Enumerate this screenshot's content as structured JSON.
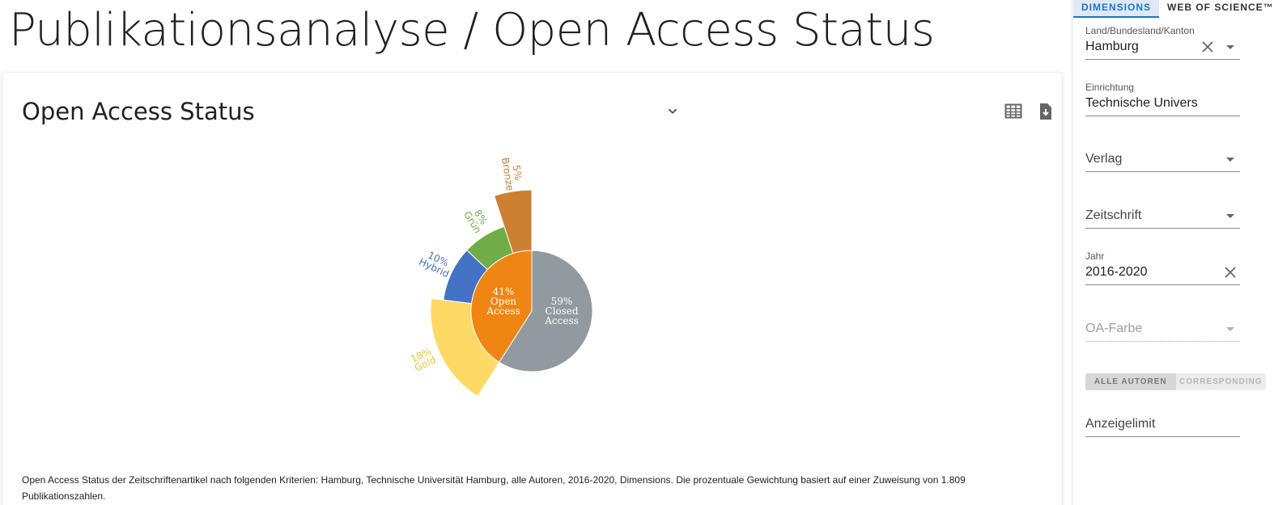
{
  "page": {
    "title": "Publikationsanalyse / Open Access Status"
  },
  "card": {
    "title": "Open Access Status",
    "caption": "Open Access Status der Zeitschriftenartikel nach folgenden Kriterien: Hamburg, Technische Universität Hamburg, alle Autoren, 2016-2020, Dimensions. Die prozentuale Gewichtung basiert auf einer Zuweisung von 1.809 Publikationszahlen.",
    "icons": [
      "chevron-down-icon",
      "table-icon",
      "download-icon"
    ]
  },
  "chart_data": {
    "type": "pie",
    "inner": [
      {
        "label_lines": [
          "41%",
          "Open",
          "Access"
        ],
        "value": 41,
        "color": "#ef8513"
      },
      {
        "label_lines": [
          "59%",
          "Closed",
          "Access"
        ],
        "value": 59,
        "color": "#919a9e"
      }
    ],
    "outer": [
      {
        "pct": "18%",
        "name": "Gold",
        "value": 18,
        "color": "#ffd966"
      },
      {
        "pct": "10%",
        "name": "Hybrid",
        "value": 10,
        "color": "#4472c4"
      },
      {
        "pct": "8%",
        "name": "Grün",
        "value": 8,
        "color": "#70ad47"
      },
      {
        "pct": "5%",
        "name": "Bronze",
        "value": 5,
        "color": "#cd7f32"
      }
    ],
    "outer_label_colors": [
      "#e8c440",
      "#4472c4",
      "#70ad47",
      "#cd7f32"
    ]
  },
  "sidebar": {
    "tabs": [
      {
        "label": "DIMENSIONS",
        "active": true
      },
      {
        "label": "WEB OF SCIENCE™",
        "active": false
      }
    ],
    "fields": {
      "land": {
        "label": "Land/Bundesland/Kanton",
        "value": "Hamburg"
      },
      "einrichtung": {
        "label": "Einrichtung",
        "value": "Technische Univers"
      },
      "verlag": {
        "placeholder": "Verlag"
      },
      "zeitschrift": {
        "placeholder": "Zeitschrift"
      },
      "jahr": {
        "label": "Jahr",
        "value": "2016-2020"
      },
      "oa_farbe": {
        "placeholder": "OA-Farbe"
      },
      "anzeigelimit": {
        "placeholder": "Anzeigelimit"
      }
    },
    "author_toggle": {
      "all": "ALLE AUTOREN",
      "corresponding": "CORRESPONDING"
    }
  }
}
